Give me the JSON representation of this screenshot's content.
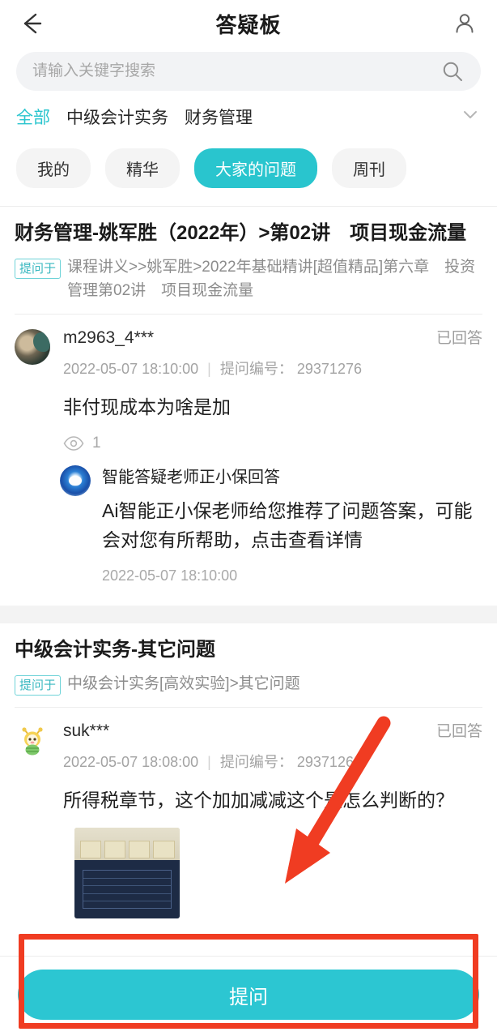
{
  "header": {
    "title": "答疑板",
    "back_icon": "arrow-left-icon",
    "profile_icon": "person-icon"
  },
  "search": {
    "placeholder": "请输入关键字搜索",
    "value": "",
    "icon": "search-icon"
  },
  "categories": {
    "items": [
      {
        "label": "全部",
        "active": true
      },
      {
        "label": "中级会计实务",
        "active": false
      },
      {
        "label": "财务管理",
        "active": false
      }
    ],
    "expand_icon": "chevron-down-icon"
  },
  "chips": [
    {
      "label": "我的",
      "active": false
    },
    {
      "label": "精华",
      "active": false
    },
    {
      "label": "大家的问题",
      "active": true
    },
    {
      "label": "周刊",
      "active": false
    }
  ],
  "posts": [
    {
      "title": "财务管理-姚军胜（2022年）>第02讲　项目现金流量",
      "tag_badge": "提问于",
      "tag_text": "课程讲义>>姚军胜>2022年基础精讲[超值精品]第六章　投资管理第02讲　项目现金流量",
      "question": {
        "avatar": "user-photo-avatar",
        "user": "m2963_4***",
        "status": "已回答",
        "time": "2022-05-07 18:10:00",
        "separator": "|",
        "id_label": "提问编号：",
        "id_value": "29371276",
        "text": "非付现成本为啥是加",
        "views_icon": "eye-icon",
        "views": "1"
      },
      "answer": {
        "avatar": "ai-robot-avatar",
        "name": "智能答疑老师正小保回答",
        "text": "Ai智能正小保老师给您推荐了问题答案，可能会对您有所帮助，点击查看详情",
        "time": "2022-05-07 18:10:00"
      }
    },
    {
      "title": "中级会计实务-其它问题",
      "tag_badge": "提问于",
      "tag_text": "中级会计实务[高效实验]>其它问题",
      "question": {
        "avatar": "bee-cartoon-avatar",
        "user": "suk***",
        "status": "已回答",
        "time": "2022-05-07 18:08:00",
        "separator": "|",
        "id_label": "提问编号：",
        "id_value": "29371268",
        "text": "所得税章节，这个加加减减这个是怎么判断的？",
        "attachment": "question-photo-thumbnail"
      }
    }
  ],
  "cta": {
    "label": "提问"
  },
  "annotations": {
    "highlight_box": "red-highlight-rectangle",
    "arrow": "red-pointer-arrow",
    "color": "#f03c22"
  },
  "colors": {
    "accent": "#29c5ce",
    "cta": "#2cc6d2",
    "annotation": "#f03c22",
    "page_bg": "#f3f3f3"
  }
}
